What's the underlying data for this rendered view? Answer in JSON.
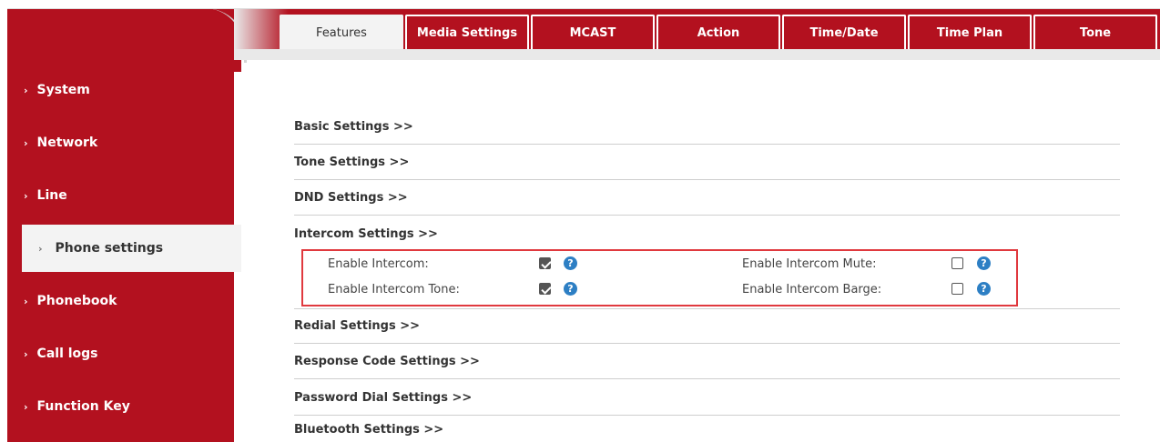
{
  "sidebar": {
    "items": [
      {
        "label": "System"
      },
      {
        "label": "Network"
      },
      {
        "label": "Line"
      },
      {
        "label": "Phone settings"
      },
      {
        "label": "Phonebook"
      },
      {
        "label": "Call logs"
      },
      {
        "label": "Function Key"
      }
    ],
    "chevron": "›"
  },
  "tabs": [
    {
      "label": "Features"
    },
    {
      "label": "Media Settings"
    },
    {
      "label": "MCAST"
    },
    {
      "label": "Action"
    },
    {
      "label": "Time/Date"
    },
    {
      "label": "Time Plan"
    },
    {
      "label": "Tone"
    }
  ],
  "sections": [
    {
      "label": "Basic Settings >>"
    },
    {
      "label": "Tone Settings >>"
    },
    {
      "label": "DND Settings >>"
    },
    {
      "label": "Intercom Settings >>"
    },
    {
      "label": "Redial Settings >>"
    },
    {
      "label": "Response Code Settings >>"
    },
    {
      "label": "Password Dial Settings >>"
    },
    {
      "label": "Bluetooth Settings >>"
    }
  ],
  "intercom": {
    "enable_intercom": {
      "label": "Enable Intercom:",
      "checked": true
    },
    "enable_intercom_tone": {
      "label": "Enable Intercom Tone:",
      "checked": true
    },
    "enable_intercom_mute": {
      "label": "Enable Intercom Mute:",
      "checked": false
    },
    "enable_intercom_barge": {
      "label": "Enable Intercom Barge:",
      "checked": false
    }
  },
  "help_glyph": "?",
  "colors": {
    "brand_red": "#b3111f",
    "highlight_border": "#e0393e",
    "help_blue": "#2d7fc4"
  }
}
